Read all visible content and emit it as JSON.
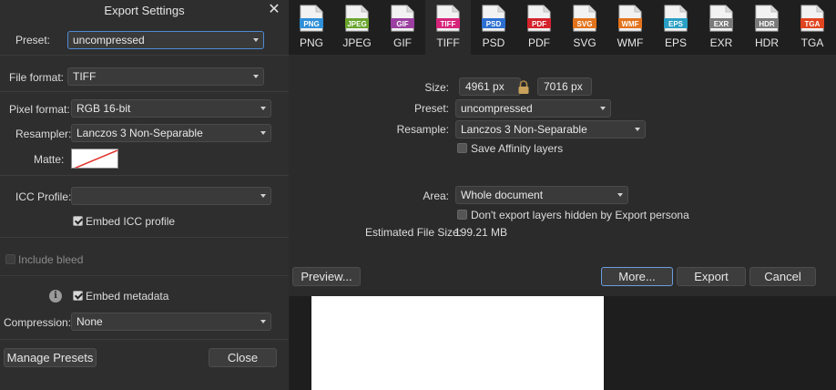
{
  "left": {
    "title": "Export Settings",
    "close_glyph": "✕",
    "preset_label": "Preset:",
    "preset_value": "uncompressed",
    "file_format_label": "File format:",
    "file_format_value": "TIFF",
    "pixel_format_label": "Pixel format:",
    "pixel_format_value": "RGB 16-bit",
    "resampler_label": "Resampler:",
    "resampler_value": "Lanczos 3 Non-Separable",
    "matte_label": "Matte:",
    "icc_profile_label": "ICC Profile:",
    "icc_profile_value": "",
    "embed_icc_label": "Embed ICC profile",
    "embed_icc_checked": true,
    "include_bleed_label": "Include bleed",
    "include_bleed_checked": false,
    "info_glyph": "i",
    "embed_metadata_label": "Embed metadata",
    "embed_metadata_checked": true,
    "compression_label": "Compression:",
    "compression_value": "None",
    "manage_presets_label": "Manage Presets",
    "close_label": "Close"
  },
  "tabs": [
    {
      "label": "PNG",
      "badge": "PNG",
      "color": "#2f8fd8",
      "active": false
    },
    {
      "label": "JPEG",
      "badge": "JPEG",
      "color": "#6aa52e",
      "active": false
    },
    {
      "label": "GIF",
      "badge": "GIF",
      "color": "#9b3fa0",
      "active": false
    },
    {
      "label": "TIFF",
      "badge": "TIFF",
      "color": "#d6247a",
      "active": true
    },
    {
      "label": "PSD",
      "badge": "PSD",
      "color": "#2c6fd1",
      "active": false
    },
    {
      "label": "PDF",
      "badge": "PDF",
      "color": "#d4232b",
      "active": false
    },
    {
      "label": "SVG",
      "badge": "SVG",
      "color": "#e3731c",
      "active": false
    },
    {
      "label": "WMF",
      "badge": "WMF",
      "color": "#e3731c",
      "active": false
    },
    {
      "label": "EPS",
      "badge": "EPS",
      "color": "#2a9fc4",
      "active": false
    },
    {
      "label": "EXR",
      "badge": "EXR",
      "color": "#7a7a7a",
      "active": false
    },
    {
      "label": "HDR",
      "badge": "HDR",
      "color": "#7a7a7a",
      "active": false
    },
    {
      "label": "TGA",
      "badge": "TGA",
      "color": "#e0451f",
      "active": false
    }
  ],
  "right": {
    "size_label": "Size:",
    "width_value": "4961 px",
    "height_value": "7016 px",
    "preset_label": "Preset:",
    "preset_value": "uncompressed",
    "resample_label": "Resample:",
    "resample_value": "Lanczos 3 Non-Separable",
    "save_affinity_label": "Save Affinity layers",
    "save_affinity_checked": false,
    "area_label": "Area:",
    "area_value": "Whole document",
    "dont_export_label": "Don't export layers hidden by Export persona",
    "dont_export_checked": false,
    "estimated_label": "Estimated File Size:",
    "estimated_value": "199.21 MB",
    "preview_button": "Preview...",
    "more_button": "More...",
    "export_button": "Export",
    "cancel_button": "Cancel"
  }
}
